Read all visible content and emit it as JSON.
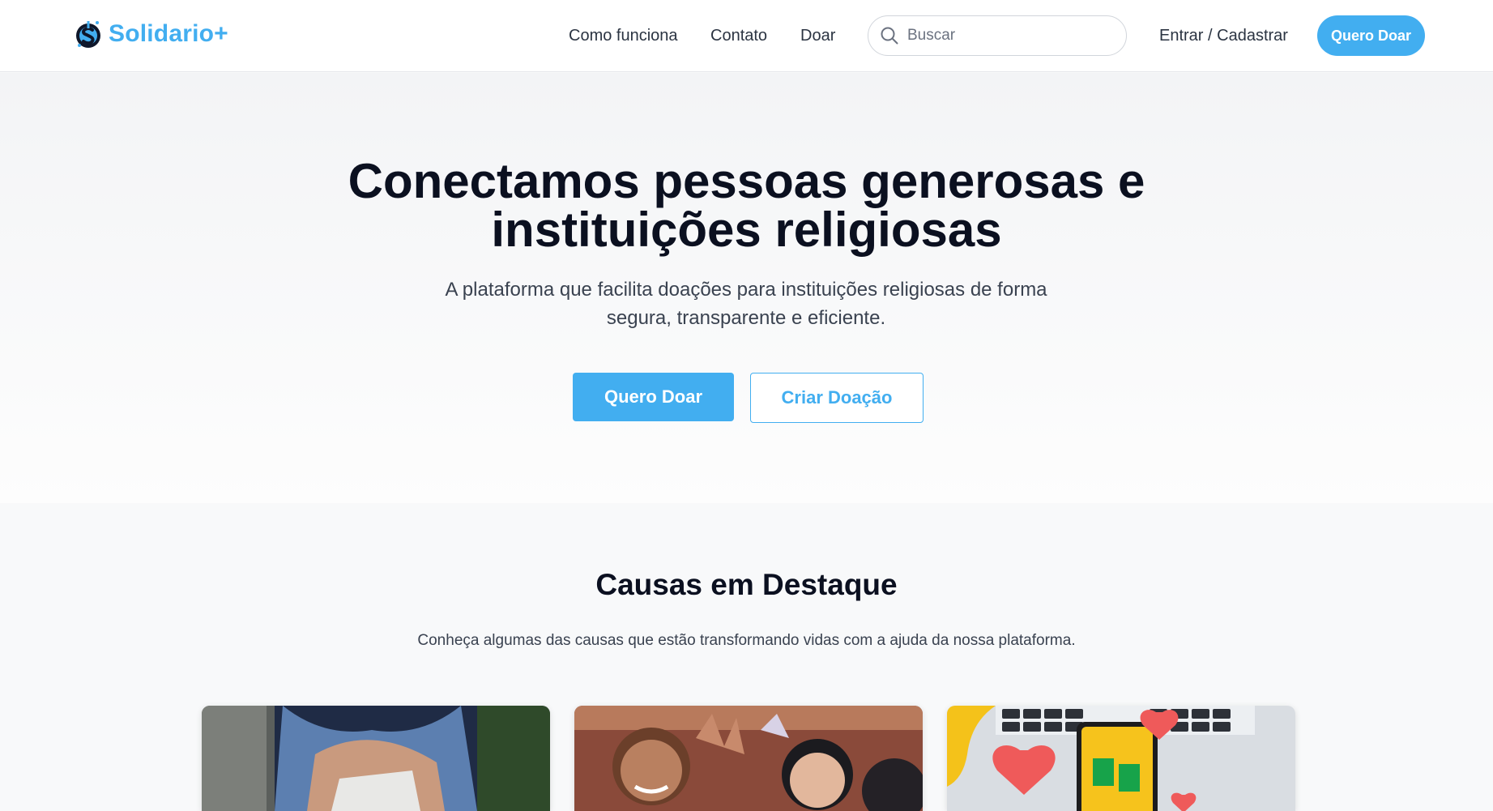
{
  "header": {
    "brand": "Solidario+",
    "nav": [
      "Como funciona",
      "Contato",
      "Doar"
    ],
    "search_placeholder": "Buscar",
    "login_label": "Entrar / Cadastrar",
    "cta_label": "Quero Doar"
  },
  "hero": {
    "title": "Conectamos pessoas generosas e instituições religiosas",
    "subtitle": "A plataforma que facilita doações para instituições religiosas de forma segura, transparente e eficiente.",
    "primary_button": "Quero Doar",
    "secondary_button": "Criar Doação"
  },
  "featured": {
    "title": "Causas em Destaque",
    "subtitle": "Conheça algumas das causas que estão transformando vidas com a ajuda da nossa plataforma.",
    "cards": [
      {
        "image": "hands-holding-paper-photo"
      },
      {
        "image": "smiling-children-photo"
      },
      {
        "image": "phone-money-hearts-illustration"
      }
    ]
  },
  "colors": {
    "accent": "#42aef0",
    "heading": "#0b1020",
    "text": "#3a4250"
  }
}
